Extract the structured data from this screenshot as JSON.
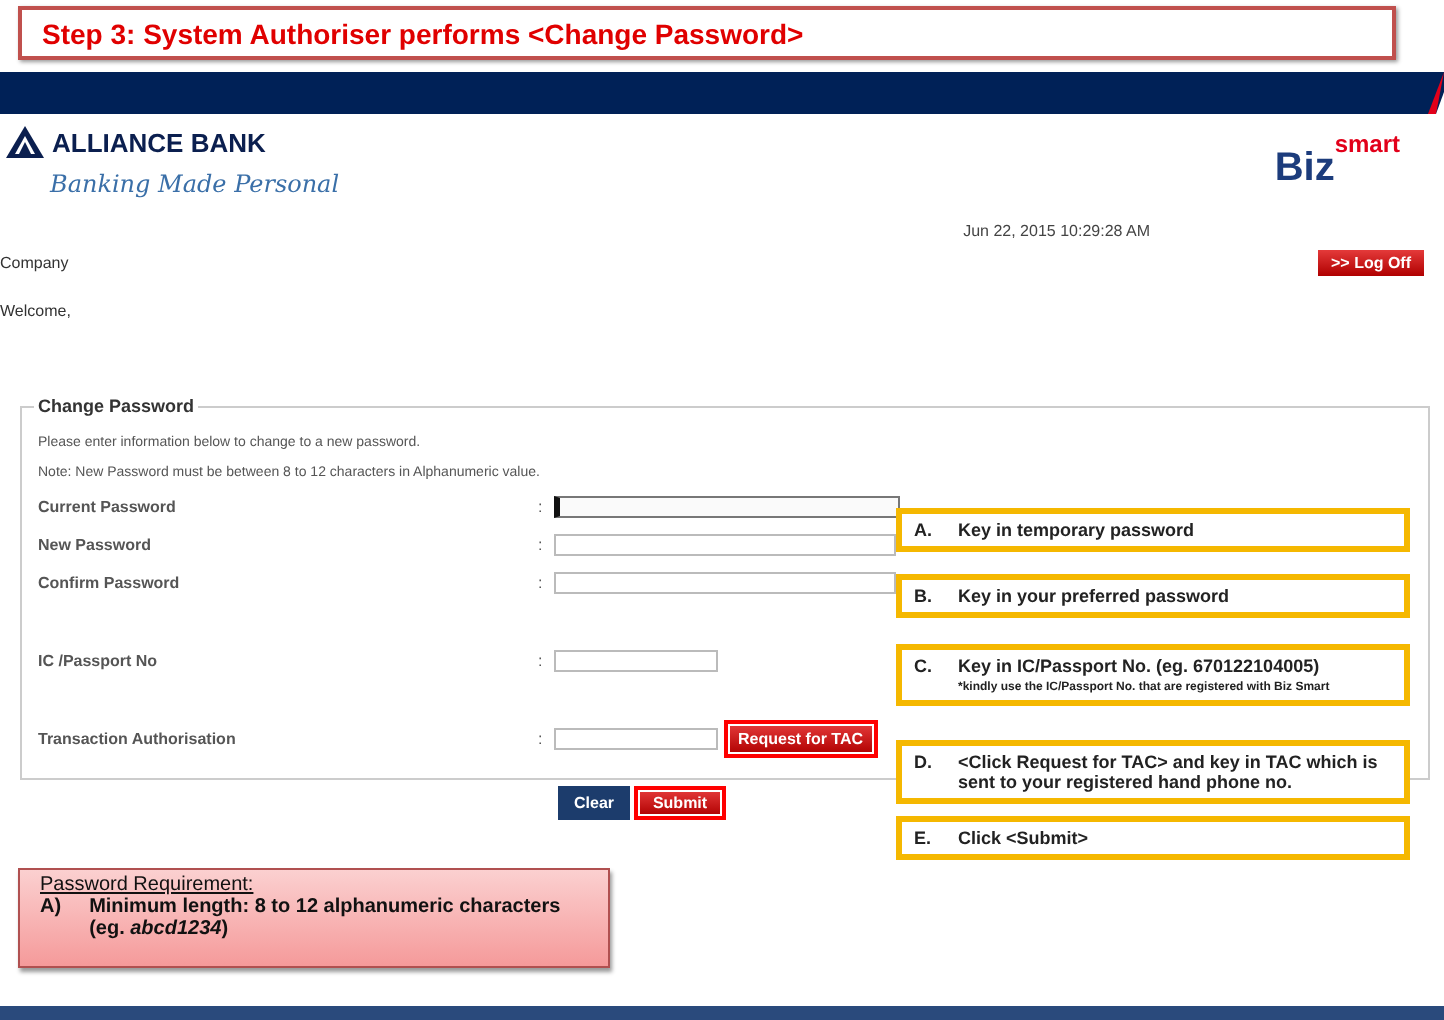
{
  "slide_title": "Step 3: System Authoriser performs <Change Password>",
  "header": {
    "bank_name": "ALLIANCE BANK",
    "tagline": "Banking Made Personal",
    "product_main": "Biz",
    "product_sup": "smart",
    "datetime": "Jun 22, 2015 10:29:28 AM"
  },
  "company_label": "Company",
  "logoff_button": ">> Log Off",
  "welcome": "Welcome,",
  "form": {
    "legend": "Change Password",
    "instruction": "Please enter information below to change to a new password.",
    "note": "Note: New Password must be between 8 to 12 characters in Alphanumeric value.",
    "field_groups": [
      [
        {
          "label": "Current Password",
          "separator": ":",
          "kind": "wide",
          "focused": true
        },
        {
          "label": "New Password",
          "separator": ":",
          "kind": "wide",
          "focused": false
        },
        {
          "label": "Confirm Password",
          "separator": ":",
          "kind": "wide",
          "focused": false
        }
      ],
      [
        {
          "label": "IC /Passport No",
          "separator": ":",
          "kind": "narrow",
          "focused": false
        }
      ],
      [
        {
          "label": "Transaction Authorisation",
          "separator": ":",
          "kind": "narrow",
          "focused": false,
          "action": {
            "label": "Request for TAC",
            "highlighted": true
          }
        }
      ]
    ],
    "buttons": [
      {
        "label": "Clear",
        "kind": "secondary",
        "highlighted": false
      },
      {
        "label": "Submit",
        "kind": "primary",
        "highlighted": true
      }
    ]
  },
  "callouts": [
    {
      "letter": "A.",
      "text": "Key in temporary password"
    },
    {
      "letter": "B.",
      "text": "Key in your preferred password"
    },
    {
      "letter": "C.",
      "text": "Key in IC/Passport No. (eg. 670122104005)",
      "note": "*kindly use the IC/Passport No. that are registered with Biz Smart"
    },
    {
      "letter": "D.",
      "text": "<Click Request for TAC> and key in TAC which is sent to your registered hand phone no."
    },
    {
      "letter": "E.",
      "text": "Click <Submit>"
    }
  ],
  "requirement": {
    "title": "Password Requirement:",
    "items": [
      {
        "marker": "A)",
        "text": "Minimum length: 8 to 12 alphanumeric characters (eg. *abcd1234*)"
      }
    ]
  }
}
